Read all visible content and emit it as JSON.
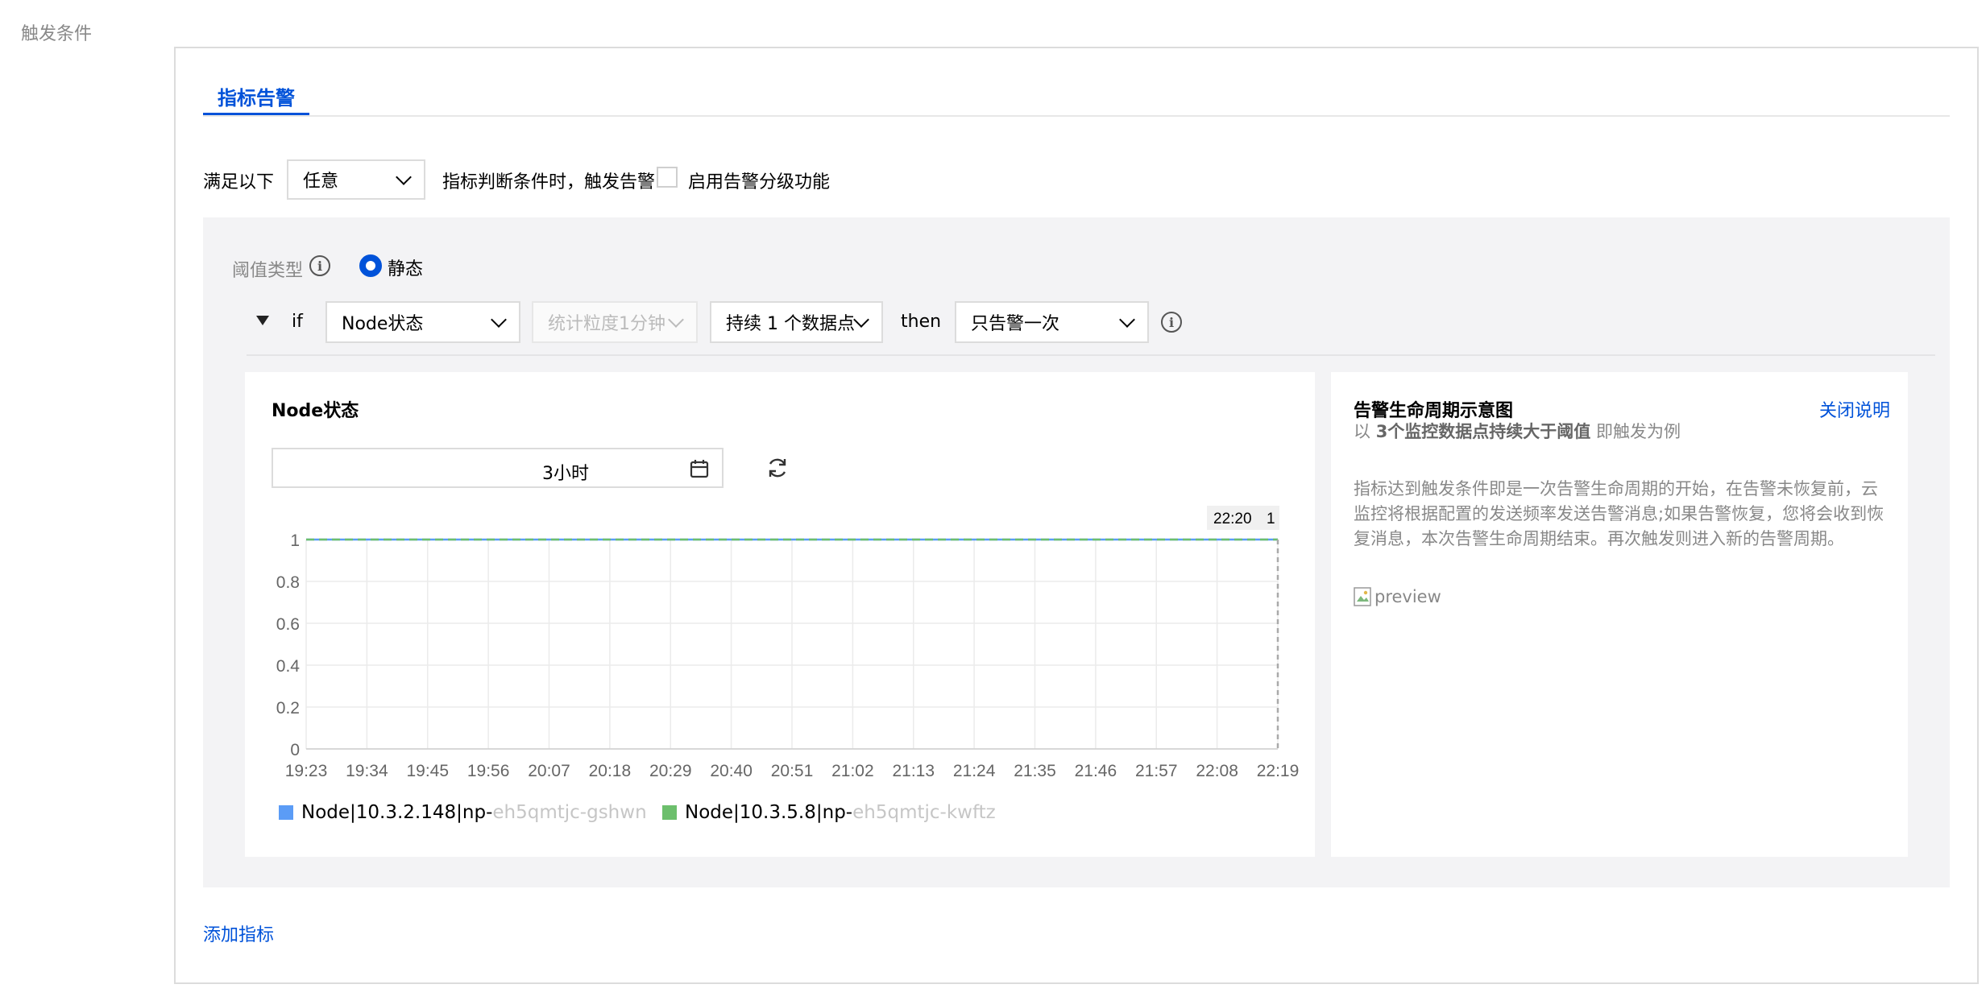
{
  "section_label": "触发条件",
  "tab": {
    "label": "指标告警"
  },
  "condition": {
    "prefix": "满足以下",
    "match_select": "任意",
    "suffix": "指标判断条件时，触发告警",
    "tiered_label": "启用告警分级功能",
    "tiered_checked": false
  },
  "threshold": {
    "type_label": "阈值类型",
    "static_label": "静态",
    "selected": "静态"
  },
  "rule": {
    "if_label": "if",
    "metric_select": "Node状态",
    "granularity_select": "统计粒度1分钟",
    "duration_select": "持续 1 个数据点",
    "then_label": "then",
    "alert_select": "只告警一次"
  },
  "chart_card": {
    "title": "Node状态",
    "time_range": "3小时",
    "tooltip_time": "22:20",
    "tooltip_value": "1"
  },
  "chart_data": {
    "type": "line",
    "title": "Node状态",
    "x": [
      "19:23",
      "19:34",
      "19:45",
      "19:56",
      "20:07",
      "20:18",
      "20:29",
      "20:40",
      "20:51",
      "21:02",
      "21:13",
      "21:24",
      "21:35",
      "21:46",
      "21:57",
      "22:08",
      "22:19"
    ],
    "y_ticks": [
      "0",
      "0.2",
      "0.4",
      "0.6",
      "0.8",
      "1"
    ],
    "ylim": [
      0,
      1
    ],
    "grid": true,
    "legend_position": "bottom-left",
    "series": [
      {
        "name": "Node|10.3.2.148|np-",
        "name_blurred": "eh5qmtjc-gshwn",
        "color": "#5b9cf6",
        "values": [
          1,
          1,
          1,
          1,
          1,
          1,
          1,
          1,
          1,
          1,
          1,
          1,
          1,
          1,
          1,
          1,
          1
        ]
      },
      {
        "name": "Node|10.3.5.8|np-",
        "name_blurred": "eh5qmtjc-kwftz",
        "color": "#6cbf6c",
        "values": [
          1,
          1,
          1,
          1,
          1,
          1,
          1,
          1,
          1,
          1,
          1,
          1,
          1,
          1,
          1,
          1,
          1
        ]
      }
    ]
  },
  "lifecycle": {
    "title": "告警生命周期示意图",
    "close_link": "关闭说明",
    "subtitle_pre": "以",
    "subtitle_bold": "3个监控数据点持续大于阈值",
    "subtitle_post": "即触发为例",
    "description": "指标达到触发条件即是一次告警生命周期的开始，在告警未恢复前，云监控将根据配置的发送频率发送告警消息;如果告警恢复，您将会收到恢复消息，本次告警生命周期结束。再次触发则进入新的告警周期。",
    "image_alt": "preview"
  },
  "add_metric": "添加指标"
}
